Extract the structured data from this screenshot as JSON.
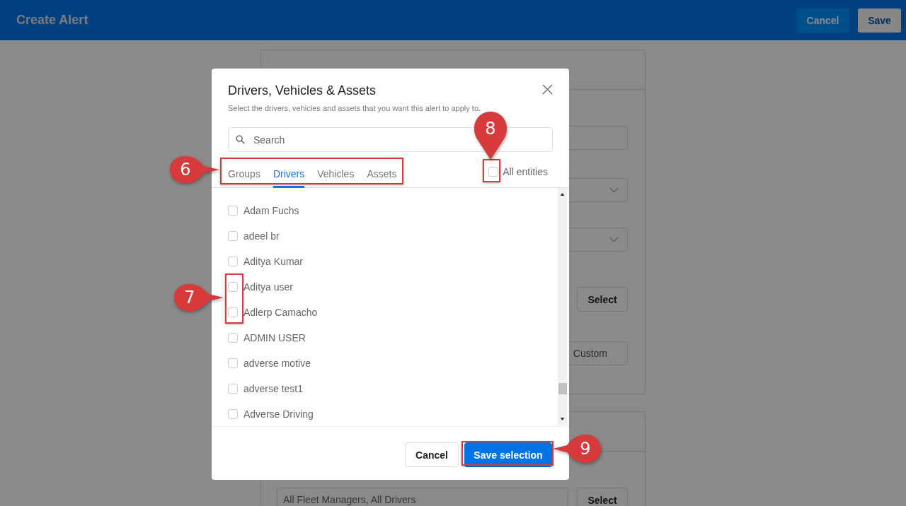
{
  "header": {
    "title": "Create Alert",
    "buttons": [
      {
        "label": "Cancel",
        "kind": "secondary"
      },
      {
        "label": "Save",
        "kind": "primary"
      }
    ]
  },
  "background": {
    "select_button": "Select",
    "custom_button": "Custom",
    "recipients_value": "All Fleet Managers, All Drivers",
    "recipients_button": "Select"
  },
  "dialog": {
    "title": "Drivers, Vehicles & Assets",
    "subtitle": "Select the drivers, vehicles and assets that you want this alert to apply to.",
    "search": {
      "placeholder": "Search"
    },
    "tabs": [
      {
        "label": "Groups",
        "selected": false
      },
      {
        "label": "Drivers",
        "selected": true
      },
      {
        "label": "Vehicles",
        "selected": false
      },
      {
        "label": "Assets",
        "selected": false
      }
    ],
    "all_entities": {
      "label": "All entities",
      "checked": false
    },
    "items": [
      {
        "name": "Adam Fuchs",
        "checked": false
      },
      {
        "name": "adeel br",
        "checked": false
      },
      {
        "name": "Aditya Kumar",
        "checked": false
      },
      {
        "name": "Aditya user",
        "checked": false
      },
      {
        "name": "Adlerp Camacho",
        "checked": false
      },
      {
        "name": "ADMIN USER",
        "checked": false
      },
      {
        "name": "adverse motive",
        "checked": false
      },
      {
        "name": "adverse test1",
        "checked": false
      },
      {
        "name": "Adverse Driving",
        "checked": false
      }
    ],
    "buttons": [
      {
        "label": "Cancel",
        "kind": "secondary"
      },
      {
        "label": "Save selection",
        "kind": "primary"
      }
    ]
  },
  "callouts": [
    {
      "number": "6"
    },
    {
      "number": "7"
    },
    {
      "number": "8"
    },
    {
      "number": "9"
    }
  ]
}
